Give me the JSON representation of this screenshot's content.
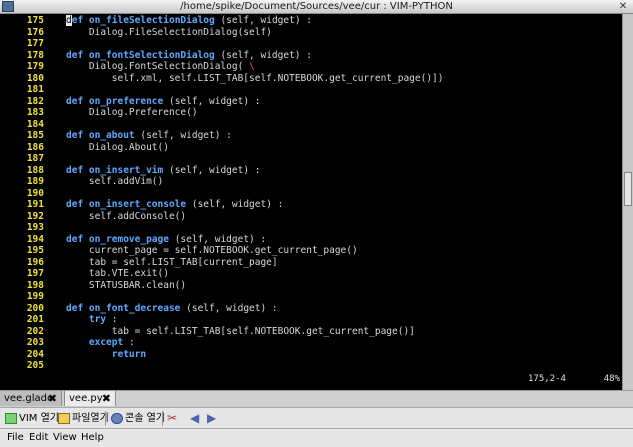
{
  "window": {
    "title": "/home/spike/Document/Sources/vee/cur : VIM-PYTHON",
    "close_glyph": "✕"
  },
  "editor": {
    "lines": [
      {
        "num": "175",
        "segs": [
          [
            "cursor",
            "d"
          ],
          [
            "kw",
            "ef "
          ],
          [
            "fn",
            "on_fileSelectionDialog"
          ],
          [
            "t",
            " (self, widget) :"
          ]
        ]
      },
      {
        "num": "176",
        "segs": [
          [
            "t",
            "    Dialog.FileSelectionDialog(self)"
          ]
        ]
      },
      {
        "num": "177",
        "segs": []
      },
      {
        "num": "178",
        "segs": [
          [
            "kw",
            "def "
          ],
          [
            "fn",
            "on_fontSelectionDialog"
          ],
          [
            "t",
            " (self, widget) :"
          ]
        ]
      },
      {
        "num": "179",
        "segs": [
          [
            "t",
            "    Dialog.FontSelectionDialog( "
          ],
          [
            "cont",
            "\\"
          ]
        ]
      },
      {
        "num": "180",
        "segs": [
          [
            "t",
            "        self.xml, self.LIST_TAB[self.NOTEBOOK.get_current_page()])"
          ]
        ]
      },
      {
        "num": "181",
        "segs": []
      },
      {
        "num": "182",
        "segs": [
          [
            "kw",
            "def "
          ],
          [
            "fn",
            "on_preference"
          ],
          [
            "t",
            " (self, widget) :"
          ]
        ]
      },
      {
        "num": "183",
        "segs": [
          [
            "t",
            "    Dialog.Preference()"
          ]
        ]
      },
      {
        "num": "184",
        "segs": []
      },
      {
        "num": "185",
        "segs": [
          [
            "kw",
            "def "
          ],
          [
            "fn",
            "on_about"
          ],
          [
            "t",
            " (self, widget) :"
          ]
        ]
      },
      {
        "num": "186",
        "segs": [
          [
            "t",
            "    Dialog.About()"
          ]
        ]
      },
      {
        "num": "187",
        "segs": []
      },
      {
        "num": "188",
        "segs": [
          [
            "kw",
            "def "
          ],
          [
            "fn",
            "on_insert_vim"
          ],
          [
            "t",
            " (self, widget) :"
          ]
        ]
      },
      {
        "num": "189",
        "segs": [
          [
            "t",
            "    self.addVim()"
          ]
        ]
      },
      {
        "num": "190",
        "segs": []
      },
      {
        "num": "191",
        "segs": [
          [
            "kw",
            "def "
          ],
          [
            "fn",
            "on_insert_console"
          ],
          [
            "t",
            " (self, widget) :"
          ]
        ]
      },
      {
        "num": "192",
        "segs": [
          [
            "t",
            "    self.addConsole()"
          ]
        ]
      },
      {
        "num": "193",
        "segs": []
      },
      {
        "num": "194",
        "segs": [
          [
            "kw",
            "def "
          ],
          [
            "fn",
            "on_remove_page"
          ],
          [
            "t",
            " (self, widget) :"
          ]
        ]
      },
      {
        "num": "195",
        "segs": [
          [
            "t",
            "    current_page = self.NOTEBOOK.get_current_page()"
          ]
        ]
      },
      {
        "num": "196",
        "segs": [
          [
            "t",
            "    tab = self.LIST_TAB[current_page]"
          ]
        ]
      },
      {
        "num": "197",
        "segs": [
          [
            "t",
            "    tab.VTE.exit()"
          ]
        ]
      },
      {
        "num": "198",
        "segs": [
          [
            "t",
            "    STATUSBAR.clean()"
          ]
        ]
      },
      {
        "num": "199",
        "segs": []
      },
      {
        "num": "200",
        "segs": [
          [
            "kw",
            "def "
          ],
          [
            "fn",
            "on_font_decrease"
          ],
          [
            "t",
            " (self, widget) :"
          ]
        ]
      },
      {
        "num": "201",
        "segs": [
          [
            "t",
            "    "
          ],
          [
            "kw",
            "try"
          ],
          [
            "t",
            " :"
          ]
        ]
      },
      {
        "num": "202",
        "segs": [
          [
            "t",
            "        tab = self.LIST_TAB[self.NOTEBOOK.get_current_page()]"
          ]
        ]
      },
      {
        "num": "203",
        "segs": [
          [
            "t",
            "    "
          ],
          [
            "kw",
            "except"
          ],
          [
            "t",
            " :"
          ]
        ]
      },
      {
        "num": "204",
        "segs": [
          [
            "t",
            "        "
          ],
          [
            "kw",
            "return"
          ]
        ]
      },
      {
        "num": "205",
        "segs": []
      }
    ],
    "status_position": "175,2-4",
    "status_percent": "48%"
  },
  "tabs": [
    {
      "label": "vee.glade",
      "close": "✖"
    },
    {
      "label": "vee.py",
      "close": "✖"
    }
  ],
  "toolbar": {
    "vim_open": "VIM 열기",
    "file_open": "파일열기",
    "console_open": "콘솔 열기",
    "tools_glyph": "✂",
    "prev_glyph": "◀",
    "next_glyph": "▶"
  },
  "menu": {
    "file": "File",
    "edit": "Edit",
    "view": "View",
    "help": "Help"
  },
  "colors": {
    "keyword": "#5fa8ff",
    "line_number": "#f0e238",
    "continuation": "#ff4040",
    "editor_bg": "#000000"
  }
}
